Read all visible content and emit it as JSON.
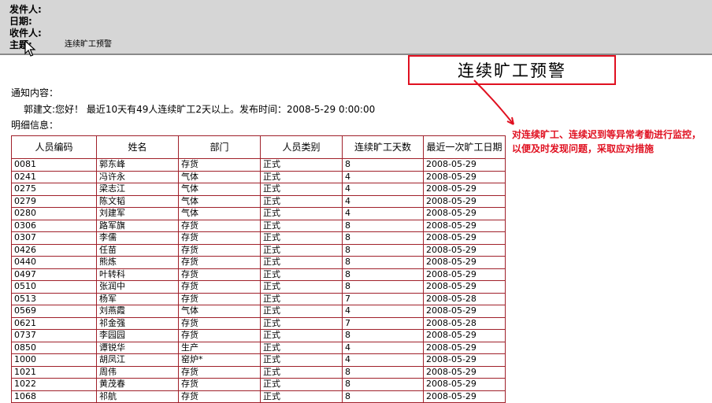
{
  "email": {
    "from_label": "发件人:",
    "date_label": "日期:",
    "to_label": "收件人:",
    "subject_label": "主题:",
    "subject_value": "连续旷工预警"
  },
  "callout": {
    "title": "连续旷工预警",
    "note": "对连续旷工、连续迟到等异常考勤进行监控，以便及时发现问题，采取应对措施",
    "accent_color": "#e01020"
  },
  "body": {
    "notice_label": "通知内容：",
    "greeting": "郭建文:您好！ 最近10天有49人连续旷工2天以上。发布时间：2008-5-29 0:00:00",
    "detail_label": "明细信息："
  },
  "table": {
    "headers": [
      "人员编码",
      "姓名",
      "部门",
      "人员类别",
      "连续旷工天数",
      "最近一次旷工日期"
    ],
    "rows": [
      [
        "0081",
        "郭东峰",
        "存货",
        "正式",
        "8",
        "2008-05-29"
      ],
      [
        "0241",
        "冯许永",
        "气体",
        "正式",
        "4",
        "2008-05-29"
      ],
      [
        "0275",
        "梁志江",
        "气体",
        "正式",
        "4",
        "2008-05-29"
      ],
      [
        "0279",
        "陈文韬",
        "气体",
        "正式",
        "4",
        "2008-05-29"
      ],
      [
        "0280",
        "刘建军",
        "气体",
        "正式",
        "4",
        "2008-05-29"
      ],
      [
        "0306",
        "路军旗",
        "存货",
        "正式",
        "8",
        "2008-05-29"
      ],
      [
        "0307",
        "李儒",
        "存货",
        "正式",
        "8",
        "2008-05-29"
      ],
      [
        "0426",
        "任苗",
        "存货",
        "正式",
        "8",
        "2008-05-29"
      ],
      [
        "0440",
        "熊炼",
        "存货",
        "正式",
        "8",
        "2008-05-29"
      ],
      [
        "0497",
        "叶转科",
        "存货",
        "正式",
        "8",
        "2008-05-29"
      ],
      [
        "0510",
        "张润中",
        "存货",
        "正式",
        "8",
        "2008-05-29"
      ],
      [
        "0513",
        "杨军",
        "存货",
        "正式",
        "7",
        "2008-05-28"
      ],
      [
        "0569",
        "刘燕霞",
        "气体",
        "正式",
        "4",
        "2008-05-29"
      ],
      [
        "0621",
        "祁金强",
        "存货",
        "正式",
        "7",
        "2008-05-28"
      ],
      [
        "0737",
        "李园园",
        "存货",
        "正式",
        "8",
        "2008-05-29"
      ],
      [
        "0850",
        "谭锐华",
        "生产",
        "正式",
        "4",
        "2008-05-29"
      ],
      [
        "1000",
        "胡凤江",
        "窑炉*",
        "正式",
        "4",
        "2008-05-29"
      ],
      [
        "1021",
        "周伟",
        "存货",
        "正式",
        "8",
        "2008-05-29"
      ],
      [
        "1022",
        "黄茂春",
        "存货",
        "正式",
        "8",
        "2008-05-29"
      ],
      [
        "1068",
        "祁航",
        "存货",
        "正式",
        "8",
        "2008-05-29"
      ]
    ]
  },
  "icons": {
    "cursor": "mouse-pointer-icon",
    "arrow": "callout-arrow-icon"
  }
}
